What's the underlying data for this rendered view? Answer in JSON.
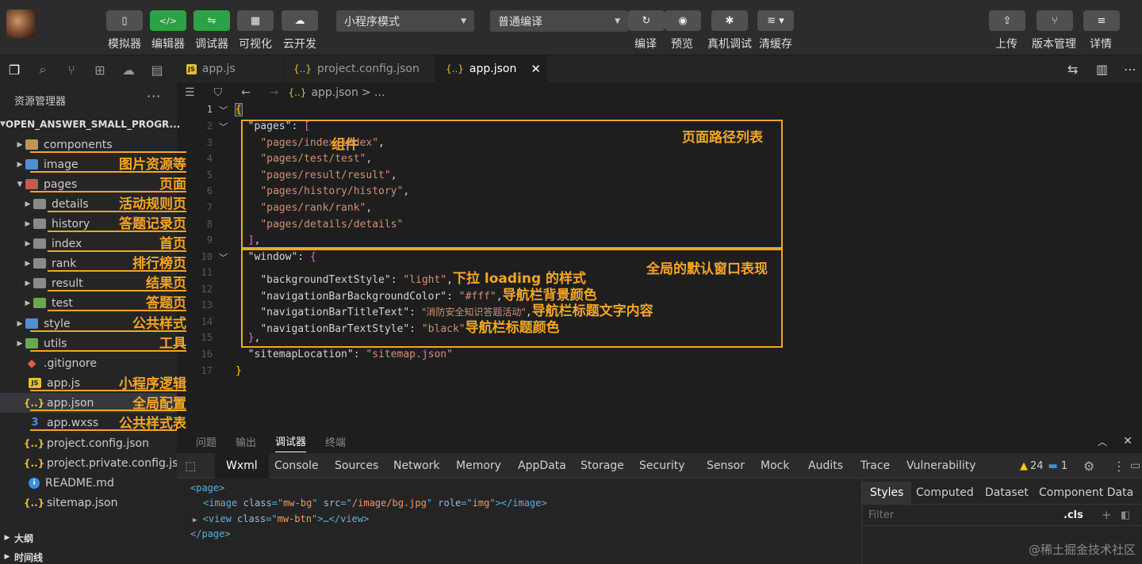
{
  "toolbar": {
    "left_buttons": [
      {
        "label": "模拟器",
        "icon": "phone-icon"
      },
      {
        "label": "编辑器",
        "icon": "code-icon"
      },
      {
        "label": "调试器",
        "icon": "debug-icon"
      },
      {
        "label": "可视化",
        "icon": "layout-icon"
      },
      {
        "label": "云开发",
        "icon": "cloud-icon"
      }
    ],
    "mode_select": "小程序模式",
    "compile_select": "普通编译",
    "mid_buttons": [
      {
        "label": "编译",
        "icon": "refresh-icon"
      },
      {
        "label": "预览",
        "icon": "eye-icon"
      },
      {
        "label": "真机调试",
        "icon": "bug-icon"
      },
      {
        "label": "清缓存",
        "icon": "layers-icon"
      }
    ],
    "right_buttons": [
      {
        "label": "上传",
        "icon": "upload-icon"
      },
      {
        "label": "版本管理",
        "icon": "branch-icon"
      },
      {
        "label": "详情",
        "icon": "menu-icon"
      }
    ]
  },
  "explorer": {
    "title": "资源管理器",
    "more": "···",
    "project": "OPEN_ANSWER_SMALL_PROGR...",
    "items": [
      {
        "label": "components",
        "note": "组件"
      },
      {
        "label": "image",
        "note": "图片资源等"
      },
      {
        "label": "pages",
        "note": "页面"
      },
      {
        "label": "details",
        "note": "活动规则页"
      },
      {
        "label": "history",
        "note": "答题记录页"
      },
      {
        "label": "index",
        "note": "首页"
      },
      {
        "label": "rank",
        "note": "排行榜页"
      },
      {
        "label": "result",
        "note": "结果页"
      },
      {
        "label": "test",
        "note": "答题页"
      },
      {
        "label": "style",
        "note": "公共样式"
      },
      {
        "label": "utils",
        "note": "工具"
      },
      {
        "label": ".gitignore",
        "note": ""
      },
      {
        "label": "app.js",
        "note": "小程序逻辑"
      },
      {
        "label": "app.json",
        "note": "全局配置"
      },
      {
        "label": "app.wxss",
        "note": "公共样式表"
      },
      {
        "label": "project.config.json",
        "note": ""
      },
      {
        "label": "project.private.config.js...",
        "note": ""
      },
      {
        "label": "README.md",
        "note": ""
      },
      {
        "label": "sitemap.json",
        "note": ""
      }
    ],
    "outline": "大纲",
    "timeline": "时间线"
  },
  "tabs": [
    {
      "label": "app.js"
    },
    {
      "label": "project.config.json"
    },
    {
      "label": "app.json"
    }
  ],
  "breadcrumb": {
    "file": "app.json",
    "rest": "> ..."
  },
  "code": {
    "line_numbers": [
      "1",
      "2",
      "3",
      "4",
      "5",
      "6",
      "7",
      "8",
      "9",
      "10",
      "11",
      "12",
      "13",
      "14",
      "15",
      "16",
      "17"
    ],
    "pages_key": "\"pages\"",
    "pages": [
      "\"pages/index/index\"",
      "\"pages/test/test\"",
      "\"pages/result/result\"",
      "\"pages/history/history\"",
      "\"pages/rank/rank\"",
      "\"pages/details/details\""
    ],
    "window_key": "\"window\"",
    "window": [
      {
        "key": "\"backgroundTextStyle\"",
        "value": "\"light\"",
        "note": "下拉 loading 的样式"
      },
      {
        "key": "\"navigationBarBackgroundColor\"",
        "value": "\"#fff\"",
        "note": "导航栏背景颜色"
      },
      {
        "key": "\"navigationBarTitleText\"",
        "value": "\"消防安全知识答题活动\"",
        "note": "导航栏标题文字内容"
      },
      {
        "key": "\"navigationBarTextStyle\"",
        "value": "\"black\"",
        "note": "导航栏标题颜色"
      }
    ],
    "sitemap_key": "\"sitemapLocation\"",
    "sitemap_value": "\"sitemap.json\"",
    "pages_box_label": "页面路径列表",
    "window_box_label": "全局的默认窗口表现"
  },
  "panel": {
    "tabs": [
      "问题",
      "输出",
      "调试器",
      "终端"
    ],
    "dev_tabs": [
      "Wxml",
      "Console",
      "Sources",
      "Network",
      "Memory",
      "AppData",
      "Storage",
      "Security",
      "Sensor",
      "Mock",
      "Audits",
      "Trace",
      "Vulnerability"
    ],
    "warnings": "24",
    "messages": "1",
    "dom": {
      "page_open": "<page>",
      "image_tag": "image",
      "image_class": "mw-bg",
      "image_src": "/image/bg.jpg",
      "image_role": "img",
      "view_tag": "view",
      "view_class": "mw-btn",
      "page_close": "</page>"
    },
    "style_tabs": [
      "Styles",
      "Computed",
      "Dataset",
      "Component Data"
    ],
    "filter_placeholder": "Filter",
    "cls": ".cls"
  },
  "watermark": "@稀土掘金技术社区"
}
